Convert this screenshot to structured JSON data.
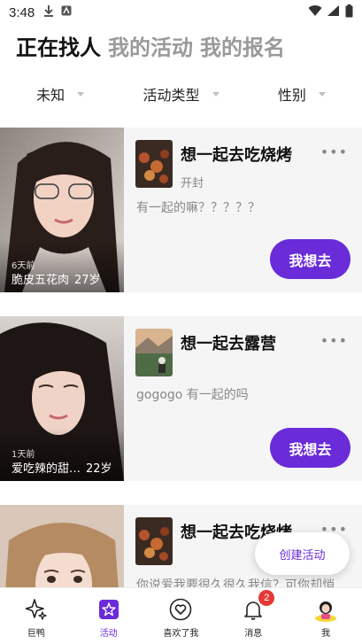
{
  "status_bar": {
    "time": "3:48"
  },
  "top_tabs": [
    "正在找人",
    "我的活动",
    "我的报名"
  ],
  "filters": [
    "未知",
    "活动类型",
    "性别"
  ],
  "cards": [
    {
      "ago": "6天前",
      "nickname": "脆皮五花肉",
      "age": "27岁",
      "title": "想一起去吃烧烤",
      "city": "开封",
      "description": "有一起的嘛？？？？？",
      "button": "我想去"
    },
    {
      "ago": "1天前",
      "nickname": "爱吃辣的甜…",
      "age": "22岁",
      "title": "想一起去露营",
      "city": "",
      "description": "gogogo   有一起的吗",
      "button": "我想去"
    },
    {
      "ago": "",
      "nickname": "",
      "age": "",
      "title": "想一起去吃烧烤",
      "city": "",
      "description": "你说爱我要很久很久我信？可你却悄",
      "button": ""
    }
  ],
  "more_label": "•••",
  "create_button": "创建活动",
  "bottom_nav": [
    {
      "label": "巨鸭",
      "icon": "sparkle-icon"
    },
    {
      "label": "活动",
      "icon": "activity-star-icon"
    },
    {
      "label": "喜欢了我",
      "icon": "heart-icon"
    },
    {
      "label": "消息",
      "icon": "bell-icon",
      "badge": "2"
    },
    {
      "label": "我",
      "icon": "avatar-icon"
    }
  ],
  "colors": {
    "accent": "#6a2bd9",
    "card_bg": "#f5f5f6",
    "badge": "#e53935"
  }
}
